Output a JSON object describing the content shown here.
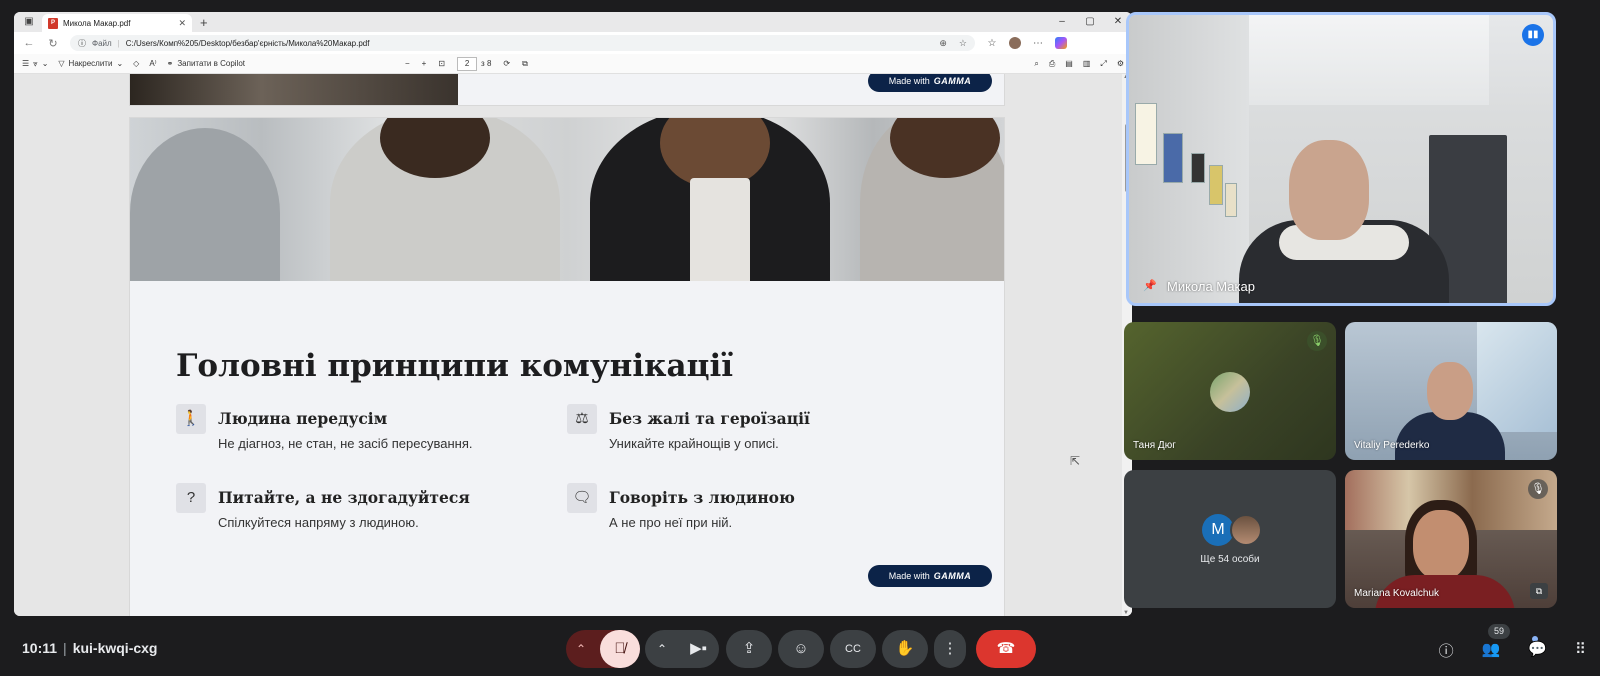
{
  "browser": {
    "tab_title": "Микола Макар.pdf",
    "window_controls": [
      "–",
      "▢",
      "✕"
    ],
    "omnibox_label": "Файл",
    "url": "C:/Users/Комп%205/Desktop/безбар'єрність/Микола%20Макар.pdf"
  },
  "pdf_toolbar": {
    "draw_label": "Накреслити",
    "copilot_label": "Запитати в Copilot",
    "page_current": "2",
    "page_total": "з 8"
  },
  "slide_prev": {
    "badge_prefix": "Made with",
    "badge_brand": "GAMMA"
  },
  "slide": {
    "title": "Головні принципи комунікації",
    "principles": [
      {
        "icon": "person-icon",
        "glyph": "🚶",
        "heading": "Людина передусім",
        "body": "Не діагноз, не стан, не засіб пересування."
      },
      {
        "icon": "scales-icon",
        "glyph": "⚖",
        "heading": "Без жалі та героїзації",
        "body": "Уникайте крайнощів у описі."
      },
      {
        "icon": "question-icon",
        "glyph": "?",
        "heading": "Питайте, а не здогадуйтеся",
        "body": "Спілкуйтеся напряму з людиною."
      },
      {
        "icon": "speech-bubble-icon",
        "glyph": "🗨",
        "heading": "Говоріть з людиною",
        "body": "А не про неї при ній."
      }
    ],
    "badge_prefix": "Made with",
    "badge_brand": "GAMMA"
  },
  "participants": {
    "main": {
      "name": "Микола Макар"
    },
    "tania": {
      "name": "Таня Дюг"
    },
    "vitaliy": {
      "name": "Vitaliy Perederko"
    },
    "others": {
      "avatar_letter": "M",
      "label": "Ще 54 особи"
    },
    "mariana": {
      "name": "Mariana Kovalchuk"
    }
  },
  "meeting": {
    "time": "10:11",
    "code": "kui-kwqi-cxg",
    "people_count": "59"
  },
  "colors": {
    "gamma_navy": "#0c2348",
    "end_call_red": "#dc362e",
    "active_speaker_border": "#a8c7fa",
    "mic_off_bg": "#f9dedc"
  }
}
